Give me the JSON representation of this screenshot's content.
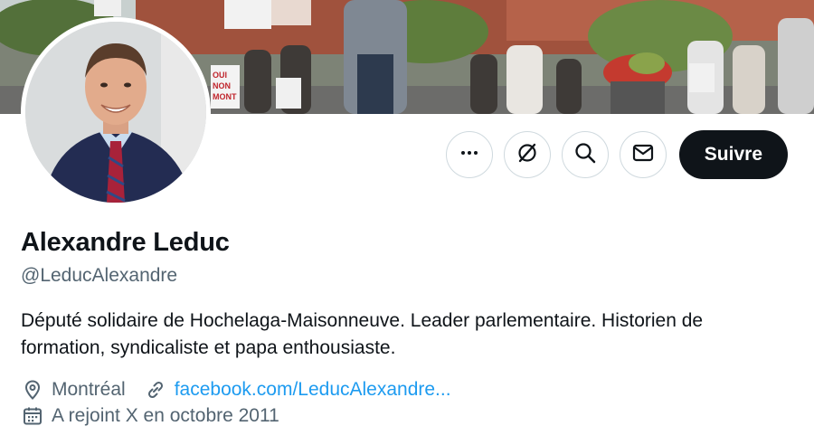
{
  "profile": {
    "name": "Alexandre Leduc",
    "handle": "@LeducAlexandre",
    "bio": "Député solidaire de Hochelaga-Maisonneuve. Leader parlementaire. Historien de formation, syndicaliste et papa enthousiaste.",
    "location": "Montréal",
    "website": "facebook.com/LeducAlexandre...",
    "joined": "A rejoint X en octobre 2011"
  },
  "actions": {
    "follow_label": "Suivre"
  },
  "banner_signs": {
    "sign1": "OUI NON MONT"
  },
  "icons": {
    "more": "more-horizontal-icon",
    "grok": "slashed-circle-icon",
    "search": "search-icon",
    "message": "envelope-icon",
    "location": "map-pin-icon",
    "website": "link-icon",
    "joined": "calendar-icon"
  },
  "colors": {
    "link": "#1d9bf0",
    "secondary_text": "#536471",
    "follow_bg": "#0f1419"
  }
}
